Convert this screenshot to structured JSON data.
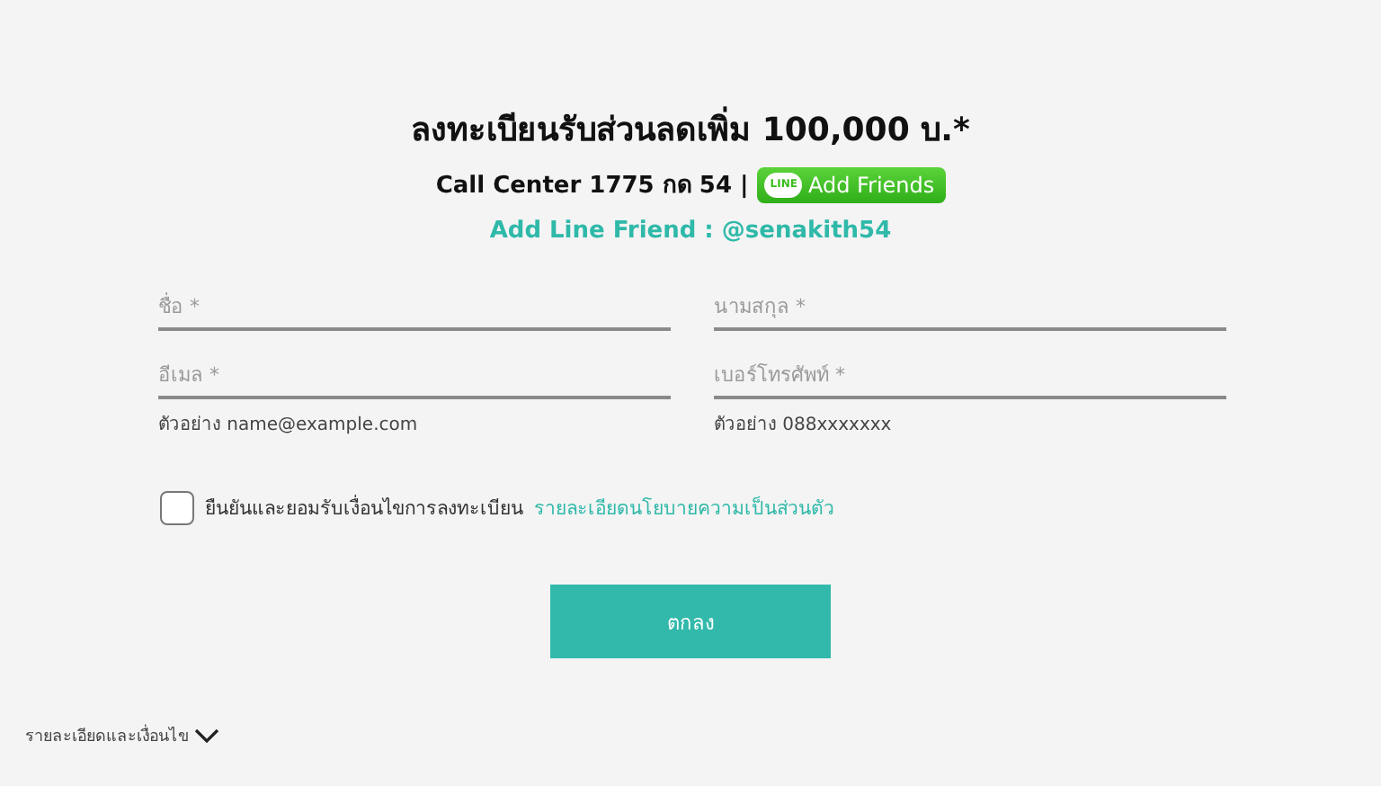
{
  "heading": "ลงทะเบียนรับส่วนลดเพิ่ม 100,000 บ.*",
  "call_center": "Call Center 1775 กด 54 |",
  "line_button": {
    "logo": "LINE",
    "label": "Add Friends"
  },
  "line_friend": "Add Line Friend : @senakith54",
  "fields": [
    {
      "placeholder": "ชื่อ *"
    },
    {
      "placeholder": "นามสกุล *"
    },
    {
      "placeholder": "อีเมล *",
      "hint": "ตัวอย่าง name@example.com"
    },
    {
      "placeholder": "เบอร์โทรศัพท์ *",
      "hint": "ตัวอย่าง 088xxxxxxx"
    }
  ],
  "consent": {
    "checked": false,
    "text": "ยืนยันและยอมรับเงื่อนไขการลงทะเบียน",
    "link": "รายละเอียดนโยบายความเป็นส่วนตัว"
  },
  "submit": "ตกลง",
  "terms": {
    "label": "รายละเอียดและเงื่อนไข",
    "expanded": false
  }
}
